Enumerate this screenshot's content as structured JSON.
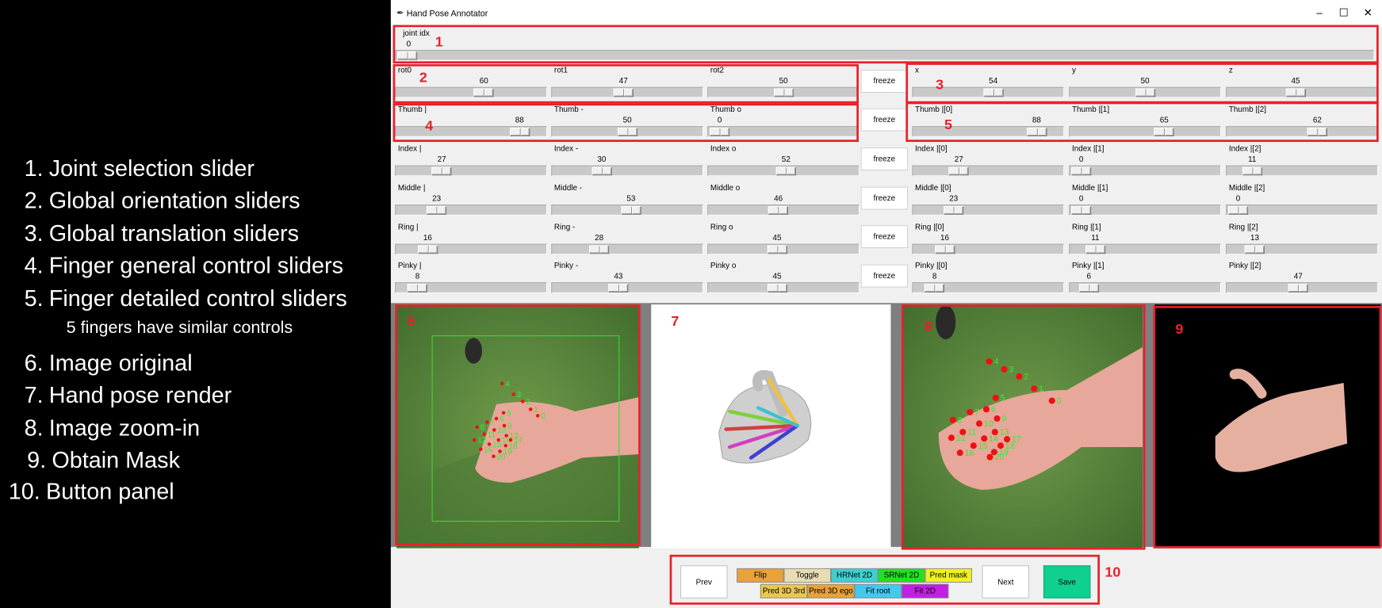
{
  "legend": {
    "items": [
      {
        "num": "1.",
        "text": "Joint selection slider"
      },
      {
        "num": "2.",
        "text": "Global orientation sliders"
      },
      {
        "num": "3.",
        "text": "Global translation sliders"
      },
      {
        "num": "4.",
        "text": "Finger general control sliders"
      },
      {
        "num": "5.",
        "text": "Finger detailed control sliders"
      },
      {
        "num": "6.",
        "text": "Image original"
      },
      {
        "num": "7.",
        "text": "Hand pose render"
      },
      {
        "num": "8.",
        "text": "Image zoom-in"
      },
      {
        "num": "9.",
        "text": "Obtain Mask"
      },
      {
        "num": "10.",
        "text": "Button panel"
      }
    ],
    "subnote": "5 fingers have similar controls"
  },
  "window": {
    "title": "Hand Pose Annotator",
    "minimize": "–",
    "maximize": "☐",
    "close": "✕"
  },
  "joint_slider": {
    "label": "joint idx",
    "value": "0",
    "fraction": 0.0
  },
  "freeze_label": "freeze",
  "sliders": {
    "rot0": {
      "label": "rot0",
      "value": "60",
      "fraction": 0.6
    },
    "rot1": {
      "label": "rot1",
      "value": "47",
      "fraction": 0.47
    },
    "rot2": {
      "label": "rot2",
      "value": "50",
      "fraction": 0.5
    },
    "x": {
      "label": "x",
      "value": "54",
      "fraction": 0.54
    },
    "y": {
      "label": "y",
      "value": "50",
      "fraction": 0.5
    },
    "z": {
      "label": "z",
      "value": "45",
      "fraction": 0.45
    },
    "thumb_bar": {
      "label": "Thumb |",
      "value": "88",
      "fraction": 0.88
    },
    "thumb_dash": {
      "label": "Thumb -",
      "value": "50",
      "fraction": 0.5
    },
    "thumb_o": {
      "label": "Thumb o",
      "value": "0",
      "fraction": 0.0
    },
    "thumb_0": {
      "label": "Thumb |[0]",
      "value": "88",
      "fraction": 0.88
    },
    "thumb_1": {
      "label": "Thumb |[1]",
      "value": "65",
      "fraction": 0.65
    },
    "thumb_2": {
      "label": "Thumb |[2]",
      "value": "62",
      "fraction": 0.62
    },
    "index_bar": {
      "label": "Index |",
      "value": "27",
      "fraction": 0.27
    },
    "index_dash": {
      "label": "Index -",
      "value": "30",
      "fraction": 0.3
    },
    "index_o": {
      "label": "Index o",
      "value": "52",
      "fraction": 0.52
    },
    "index_0": {
      "label": "Index |[0]",
      "value": "27",
      "fraction": 0.27
    },
    "index_1": {
      "label": "Index |[1]",
      "value": "0",
      "fraction": 0.0
    },
    "index_2": {
      "label": "Index |[2]",
      "value": "11",
      "fraction": 0.11
    },
    "middle_bar": {
      "label": "Middle |",
      "value": "23",
      "fraction": 0.23
    },
    "middle_dash": {
      "label": "Middle -",
      "value": "53",
      "fraction": 0.53
    },
    "middle_o": {
      "label": "Middle o",
      "value": "46",
      "fraction": 0.46
    },
    "middle_0": {
      "label": "Middle |[0]",
      "value": "23",
      "fraction": 0.23
    },
    "middle_1": {
      "label": "Middle |[1]",
      "value": "0",
      "fraction": 0.0
    },
    "middle_2": {
      "label": "Middle |[2]",
      "value": "0",
      "fraction": 0.0
    },
    "ring_bar": {
      "label": "Ring |",
      "value": "16",
      "fraction": 0.16
    },
    "ring_dash": {
      "label": "Ring -",
      "value": "28",
      "fraction": 0.28
    },
    "ring_o": {
      "label": "Ring o",
      "value": "45",
      "fraction": 0.45
    },
    "ring_0": {
      "label": "Ring |[0]",
      "value": "16",
      "fraction": 0.16
    },
    "ring_1": {
      "label": "Ring |[1]",
      "value": "11",
      "fraction": 0.11
    },
    "ring_2": {
      "label": "Ring |[2]",
      "value": "13",
      "fraction": 0.13
    },
    "pinky_bar": {
      "label": "Pinky |",
      "value": "8",
      "fraction": 0.08
    },
    "pinky_dash": {
      "label": "Pinky -",
      "value": "43",
      "fraction": 0.43
    },
    "pinky_o": {
      "label": "Pinky o",
      "value": "45",
      "fraction": 0.45
    },
    "pinky_0": {
      "label": "Pinky |[0]",
      "value": "8",
      "fraction": 0.08
    },
    "pinky_1": {
      "label": "Pinky |[1]",
      "value": "6",
      "fraction": 0.06
    },
    "pinky_2": {
      "label": "Pinky |[2]",
      "value": "47",
      "fraction": 0.47
    }
  },
  "annotations": {
    "n1": "1",
    "n2": "2",
    "n3": "3",
    "n4": "4",
    "n5": "5",
    "n6": "6",
    "n7": "7",
    "n8": "8",
    "n9": "9",
    "n10": "10"
  },
  "keypoint_labels": [
    "0",
    "1",
    "2",
    "3",
    "4",
    "5",
    "6",
    "7",
    "8",
    "9",
    "10",
    "11",
    "12",
    "13",
    "14",
    "15",
    "16",
    "17",
    "18",
    "19",
    "20"
  ],
  "buttons": {
    "prev": "Prev",
    "next": "Next",
    "save": "Save",
    "flip": "Flip",
    "toggle": "Toggle",
    "hrnet": "HRNet 2D",
    "srnet": "SRNet 2D",
    "pred_mask": "Pred mask",
    "pred3d_3rd": "Pred 3D 3rd",
    "pred3d_ego": "Pred 3D ego",
    "fit_root": "Fit root",
    "fit2d": "Fit 2D"
  },
  "colors": {
    "annotation_red": "#e8202a",
    "flip": "#e8a23a",
    "toggle": "#e8dcb4",
    "hrnet": "#3cd0d0",
    "srnet": "#22e022",
    "pred_mask": "#f0f020",
    "pred3d_3rd": "#e8c850",
    "pred3d_ego": "#e8a23a",
    "fit_root": "#44c8f0",
    "fit2d": "#c020e0",
    "save": "#10d090",
    "keypoint": "#ee1111",
    "keypoint_label": "#33ee33"
  }
}
